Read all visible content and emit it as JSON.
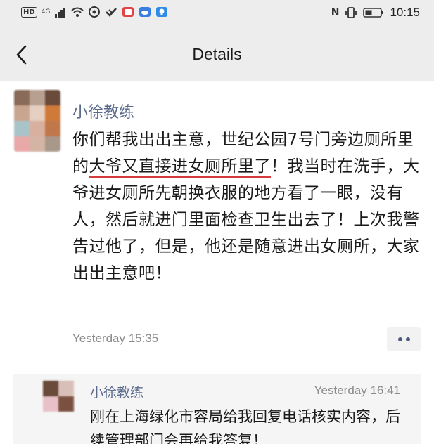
{
  "status_bar": {
    "hd": "HD",
    "signal": "4G",
    "time": "10:15",
    "icons": [
      "wifi-icon",
      "vpn-icon",
      "checkmark-icon",
      "red-app-icon",
      "cloud-icon",
      "bulb-icon",
      "nfc-icon",
      "vibrate-icon",
      "battery-icon"
    ]
  },
  "nav": {
    "title": "Details"
  },
  "post": {
    "author": "小徐教练",
    "body_part1": "你们帮我出出主意，世纪公园7号门旁边厕所里的",
    "body_underlined": "大爷又直接进女厕所里了",
    "body_part2": "！我当时在洗手，大爷进女厕所先朝换衣服的地方看了一眼，没有人，然后就进门里面检查卫生出去了！上次我警告过他了，但是，他还是随意进出女厕所，大家出出主意吧！",
    "time": "Yesterday 15:35"
  },
  "comment": {
    "author": "小徐教练",
    "time": "Yesterday 16:41",
    "body": "刚在上海绿化市容局给我回复电话核实内容，后续管理部门会再给我答复！"
  },
  "colors": {
    "author": "#5b6b8c",
    "underline": "#d63a3a",
    "background": "#ededed"
  }
}
